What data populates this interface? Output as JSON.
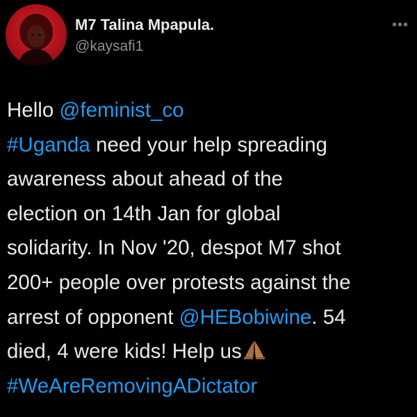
{
  "user": {
    "display_name": "M7 Talina Mpapula.",
    "handle": "@kaysafi1"
  },
  "more_menu": {
    "label": "•••"
  },
  "tweet": {
    "lines": [
      [
        {
          "t": "Hello ",
          "link": false
        },
        {
          "t": "@feminist_co",
          "link": true
        }
      ],
      [
        {
          "t": "#Uganda",
          "link": true
        },
        {
          "t": " need your help spreading",
          "link": false
        }
      ],
      [
        {
          "t": "awareness about ahead of the",
          "link": false
        }
      ],
      [
        {
          "t": "election on 14th Jan for global",
          "link": false
        }
      ],
      [
        {
          "t": "solidarity. In Nov '20, despot M7 shot",
          "link": false
        }
      ],
      [
        {
          "t": "200+ people over protests against the",
          "link": false
        }
      ],
      [
        {
          "t": "arrest of opponent ",
          "link": false
        },
        {
          "t": "@HEBobiwine",
          "link": true
        },
        {
          "t": ". 54",
          "link": false
        }
      ],
      [
        {
          "t": "died, 4 were kids! Help us",
          "link": false
        }
      ],
      [
        {
          "t": "#WeAreRemovingADictator",
          "link": true
        }
      ]
    ],
    "emoji": "folded-hands-emoji"
  },
  "colors": {
    "background": "#000000",
    "text": "#e7e9ea",
    "link": "#1d9bf0",
    "secondary": "#8b9298"
  }
}
